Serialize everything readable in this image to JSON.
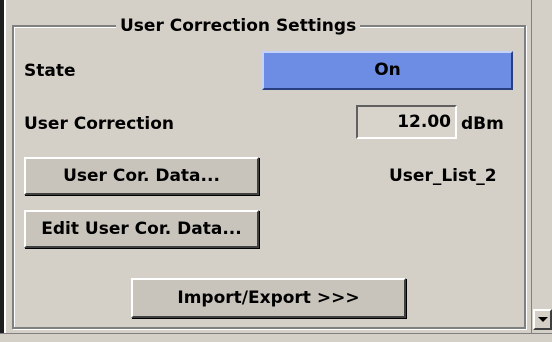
{
  "panel": {
    "title": "User Correction Settings",
    "state_label": "State",
    "state_value": "On",
    "user_correction_label": "User Correction",
    "user_correction_value": "12.00",
    "user_correction_unit": "dBm",
    "cor_data_button": "User Cor. Data...",
    "cor_data_list": "User_List_2",
    "edit_cor_data_button": "Edit User Cor. Data...",
    "import_export_button": "Import/Export >>>"
  },
  "colors": {
    "background": "#d4d0c8",
    "state_active": "#6d8ce3"
  },
  "icons": {
    "scroll_down": "chevron-down-icon"
  }
}
